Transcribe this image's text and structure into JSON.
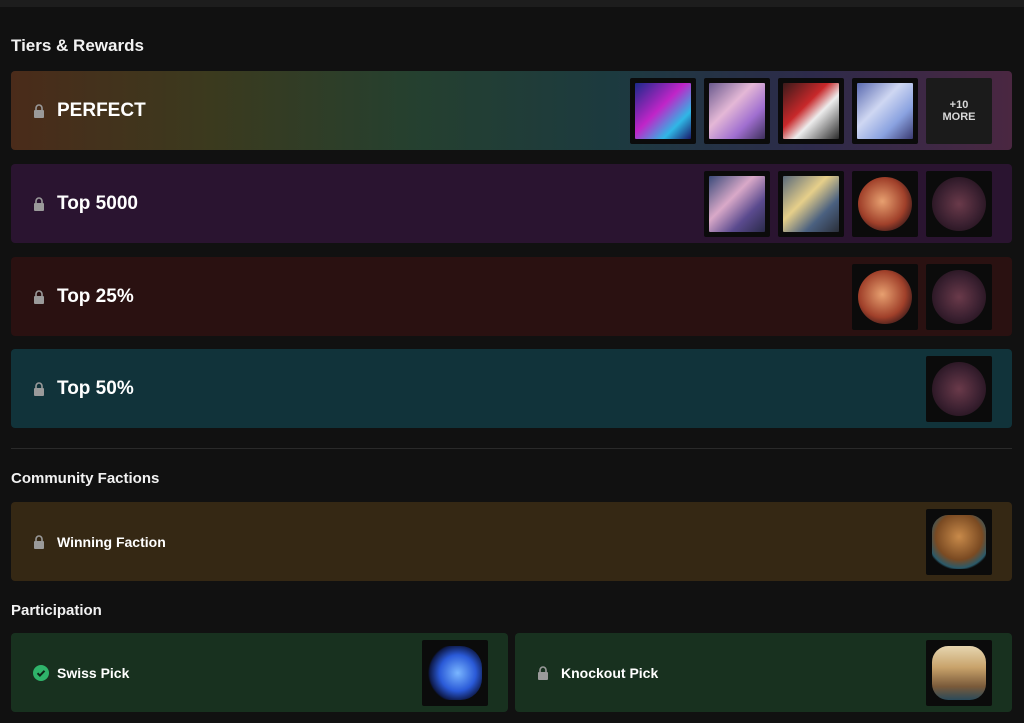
{
  "sections": {
    "tiers_title": "Tiers & Rewards",
    "community_title": "Community Factions",
    "participation_title": "Participation"
  },
  "tiers": [
    {
      "label": "PERFECT",
      "status": "locked",
      "more_badge": "+10\nMORE"
    },
    {
      "label": "Top 5000",
      "status": "locked"
    },
    {
      "label": "Top 25%",
      "status": "locked"
    },
    {
      "label": "Top 50%",
      "status": "locked"
    }
  ],
  "community": {
    "label": "Winning Faction",
    "status": "locked"
  },
  "participation": [
    {
      "label": "Swiss Pick",
      "status": "completed"
    },
    {
      "label": "Knockout Pick",
      "status": "locked"
    }
  ],
  "colors": {
    "background": "#111111",
    "top5000": "#2a1430",
    "top25": "#2a1111",
    "top50": "#11333a",
    "faction": "#352814",
    "participation": "#18311f",
    "check": "#2fb36a"
  }
}
